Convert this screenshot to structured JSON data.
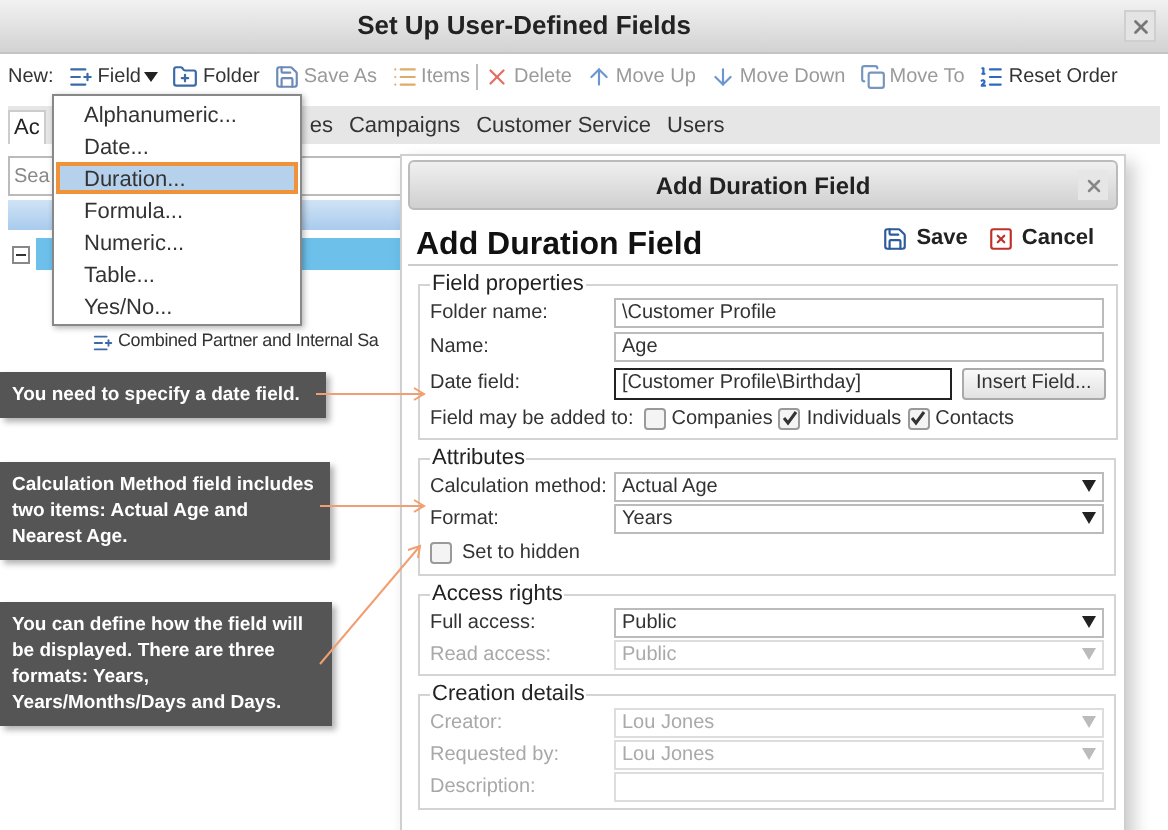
{
  "window": {
    "title": "Set Up User-Defined Fields"
  },
  "toolbar": {
    "label": "New:",
    "items": [
      {
        "label": "Field",
        "disabled": false,
        "dropdown": true
      },
      {
        "label": "Folder",
        "disabled": false
      },
      {
        "label": "Save As",
        "disabled": true
      },
      {
        "label": "Items",
        "disabled": true
      },
      {
        "label": "Delete",
        "disabled": true
      },
      {
        "label": "Move Up",
        "disabled": true
      },
      {
        "label": "Move Down",
        "disabled": true
      },
      {
        "label": "Move To",
        "disabled": true
      },
      {
        "label": "Reset Order",
        "disabled": false
      }
    ]
  },
  "tabs": [
    {
      "label": "Ac",
      "selected": true
    },
    {
      "label": "es",
      "selected": false
    },
    {
      "label": "Campaigns",
      "selected": false
    },
    {
      "label": "Customer Service",
      "selected": false
    },
    {
      "label": "Users",
      "selected": false
    }
  ],
  "search": {
    "placeholder": "Sea"
  },
  "tree": [
    {
      "expanded": true,
      "children": [
        {
          "label": "Combined Partner and Internal Sa"
        }
      ]
    }
  ],
  "field_menu": [
    {
      "label": "Alphanumeric...",
      "selected": false
    },
    {
      "label": "Date...",
      "selected": false
    },
    {
      "label": "Duration...",
      "selected": true
    },
    {
      "label": "Formula...",
      "selected": false
    },
    {
      "label": "Numeric...",
      "selected": false
    },
    {
      "label": "Table...",
      "selected": false
    },
    {
      "label": "Yes/No...",
      "selected": false
    }
  ],
  "dialog": {
    "title": "Add Duration Field",
    "heading": "Add Duration Field",
    "actions": [
      "Save",
      "Cancel"
    ],
    "sections": [
      {
        "legend": "Field properties",
        "rows": [
          {
            "kind": "text",
            "label": "Folder name:",
            "value": "\\Customer Profile"
          },
          {
            "kind": "text",
            "label": "Name:",
            "value": "Age"
          },
          {
            "kind": "field_button",
            "label": "Date field:",
            "value": "[Customer Profile\\Birthday]",
            "button": "Insert Field..."
          },
          {
            "kind": "checkboxes",
            "label": "Field may be added to:",
            "options": [
              {
                "label": "Companies",
                "checked": false
              },
              {
                "label": "Individuals",
                "checked": true
              },
              {
                "label": "Contacts",
                "checked": true
              }
            ]
          }
        ]
      },
      {
        "legend": "Attributes",
        "rows": [
          {
            "kind": "select",
            "label": "Calculation method:",
            "value": "Actual Age",
            "disabled": false
          },
          {
            "kind": "select",
            "label": "Format:",
            "value": "Years",
            "disabled": false
          },
          {
            "kind": "checkbox",
            "label": "Set to hidden",
            "checked": false
          }
        ]
      },
      {
        "legend": "Access rights",
        "rows": [
          {
            "kind": "select",
            "label": "Full access:",
            "value": "Public",
            "disabled": false
          },
          {
            "kind": "select",
            "label": "Read access:",
            "value": "Public",
            "disabled": true
          }
        ]
      },
      {
        "legend": "Creation details",
        "rows": [
          {
            "kind": "select",
            "label": "Creator:",
            "value": "Lou Jones",
            "disabled": true
          },
          {
            "kind": "select",
            "label": "Requested by:",
            "value": "Lou Jones",
            "disabled": true
          },
          {
            "kind": "text",
            "label": "Description:",
            "value": "",
            "disabled": true
          }
        ]
      }
    ]
  },
  "callouts": [
    "You need to specify a date field.",
    "Calculation Method field includes two items: Actual Age and Nearest Age.",
    "You can define how the field will be displayed. There are three formats: Years, Years/Months/Days and Days."
  ]
}
